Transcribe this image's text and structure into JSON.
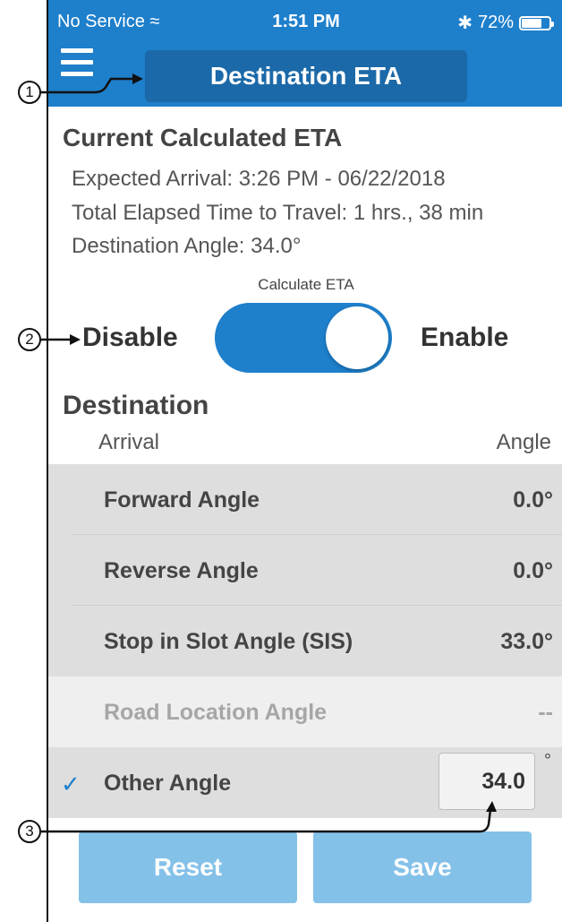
{
  "status_bar": {
    "carrier": "No Service",
    "time": "1:51 PM",
    "battery": "72%",
    "battery_fraction": 0.72
  },
  "header": {
    "title": "Destination ETA",
    "menu_icon": "hamburger-icon"
  },
  "eta": {
    "section_title": "Current Calculated ETA",
    "expected_arrival": "Expected Arrival: 3:26 PM - 06/22/2018",
    "elapsed_time": "Total Elapsed Time to Travel: 1 hrs., 38 min",
    "destination_angle": "Destination Angle: 34.0°"
  },
  "calculate": {
    "label": "Calculate ETA",
    "off_label": "Disable",
    "on_label": "Enable",
    "enabled": true
  },
  "destination": {
    "title": "Destination",
    "col_arrival": "Arrival",
    "col_angle": "Angle",
    "rows": [
      {
        "name": "Forward Angle",
        "value": "0.0°"
      },
      {
        "name": "Reverse Angle",
        "value": "0.0°"
      },
      {
        "name": "Stop in Slot Angle (SIS)",
        "value": "33.0°"
      },
      {
        "name": "Road Location Angle",
        "value": "--"
      },
      {
        "name": "Other Angle",
        "value": "34.0",
        "unit": "°"
      }
    ]
  },
  "buttons": {
    "reset": "Reset",
    "save": "Save"
  },
  "callouts": [
    "1",
    "2",
    "3"
  ],
  "colors": {
    "primary": "#1e7fcb",
    "title_button": "#1b69a8",
    "action_button": "#84c1e9",
    "row_bg": "#dedede",
    "disabled_row_bg": "#efefef"
  }
}
